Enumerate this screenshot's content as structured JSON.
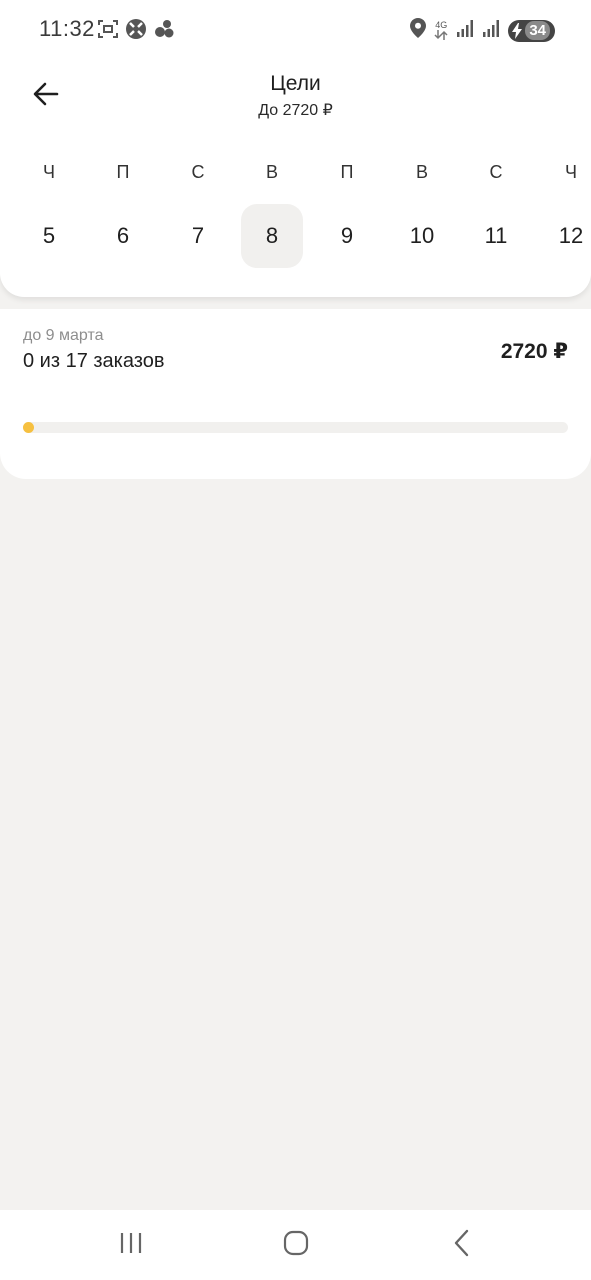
{
  "status_bar": {
    "time": "11:32",
    "network": "4G",
    "battery": "34",
    "icons_left": [
      "screenshot-icon",
      "soccer-ball-icon",
      "dots-cluster-icon"
    ],
    "icons_right": [
      "location-icon",
      "network-4g-icon",
      "signal-icon",
      "signal-icon-2",
      "battery-charging-icon"
    ]
  },
  "header": {
    "title": "Цели",
    "subtitle": "До 2720 ₽",
    "back_icon": "arrow-left-icon"
  },
  "calendar": {
    "selected_index": 3,
    "days": [
      {
        "weekday": "Ч",
        "number": "5"
      },
      {
        "weekday": "П",
        "number": "6"
      },
      {
        "weekday": "С",
        "number": "7"
      },
      {
        "weekday": "В",
        "number": "8"
      },
      {
        "weekday": "П",
        "number": "9"
      },
      {
        "weekday": "В",
        "number": "10"
      },
      {
        "weekday": "С",
        "number": "11"
      },
      {
        "weekday": "Ч",
        "number": "12"
      }
    ]
  },
  "goal": {
    "deadline": "до 9 марта",
    "progress_text": "0 из 17 заказов",
    "amount": "2720 ₽",
    "progress_fraction": 0,
    "accent_color": "#f6c040"
  },
  "nav_bar": {
    "icons": [
      "recent-apps-icon",
      "home-icon",
      "back-icon"
    ]
  }
}
